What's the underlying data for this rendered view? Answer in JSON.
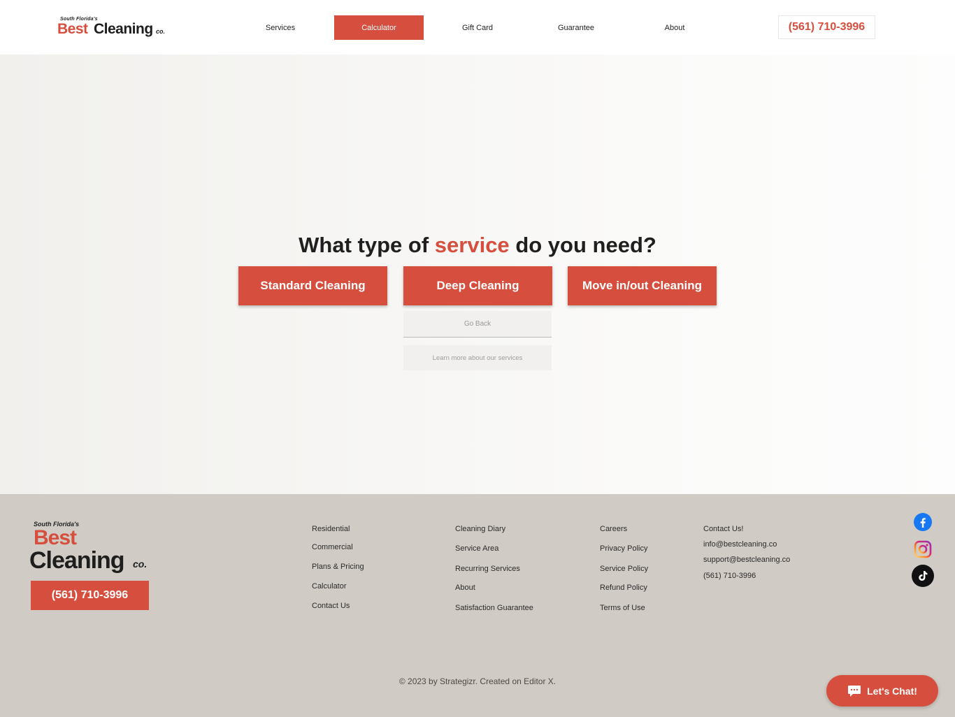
{
  "brand": {
    "tagline": "South Florida's",
    "name_part1": "Best",
    "name_part2": "Cleaning",
    "suffix": "co.",
    "accent_color": "#d64f3e"
  },
  "nav": {
    "items": [
      {
        "label": "Services"
      },
      {
        "label": "Calculator",
        "active": true
      },
      {
        "label": "Gift Card"
      },
      {
        "label": "Guarantee"
      },
      {
        "label": "About"
      }
    ],
    "phone": "(561) 710-3996"
  },
  "hero": {
    "question_pre": "What type of",
    "question_accent": "service",
    "question_post": "do you need?",
    "options": [
      {
        "label": "Standard Cleaning"
      },
      {
        "label": "Deep Cleaning"
      },
      {
        "label": "Move in/out Cleaning"
      }
    ],
    "go_back": "Go Back",
    "learn_more": "Learn more about our services"
  },
  "footer": {
    "phone": "(561) 710-3996",
    "col1": [
      "Residential",
      "Commercial",
      "Plans & Pricing",
      "Calculator",
      "Contact Us"
    ],
    "col2": [
      "Cleaning Diary",
      "Service Area",
      "Recurring Services",
      "About",
      "Satisfaction Guarantee"
    ],
    "col3": [
      "Careers",
      "Privacy Policy",
      "Service Policy",
      "Refund Policy",
      "Terms of Use"
    ],
    "contact": {
      "heading": "Contact Us!",
      "email1": "info@bestcleaning.co",
      "email2": "support@bestcleaning.co",
      "phone": "(561) 710-3996"
    },
    "social": [
      "facebook-icon",
      "instagram-icon",
      "tiktok-icon"
    ],
    "copyright": "© 2023 by Strategizr. Created on Editor X."
  },
  "chat": {
    "label": "Let's Chat!"
  }
}
